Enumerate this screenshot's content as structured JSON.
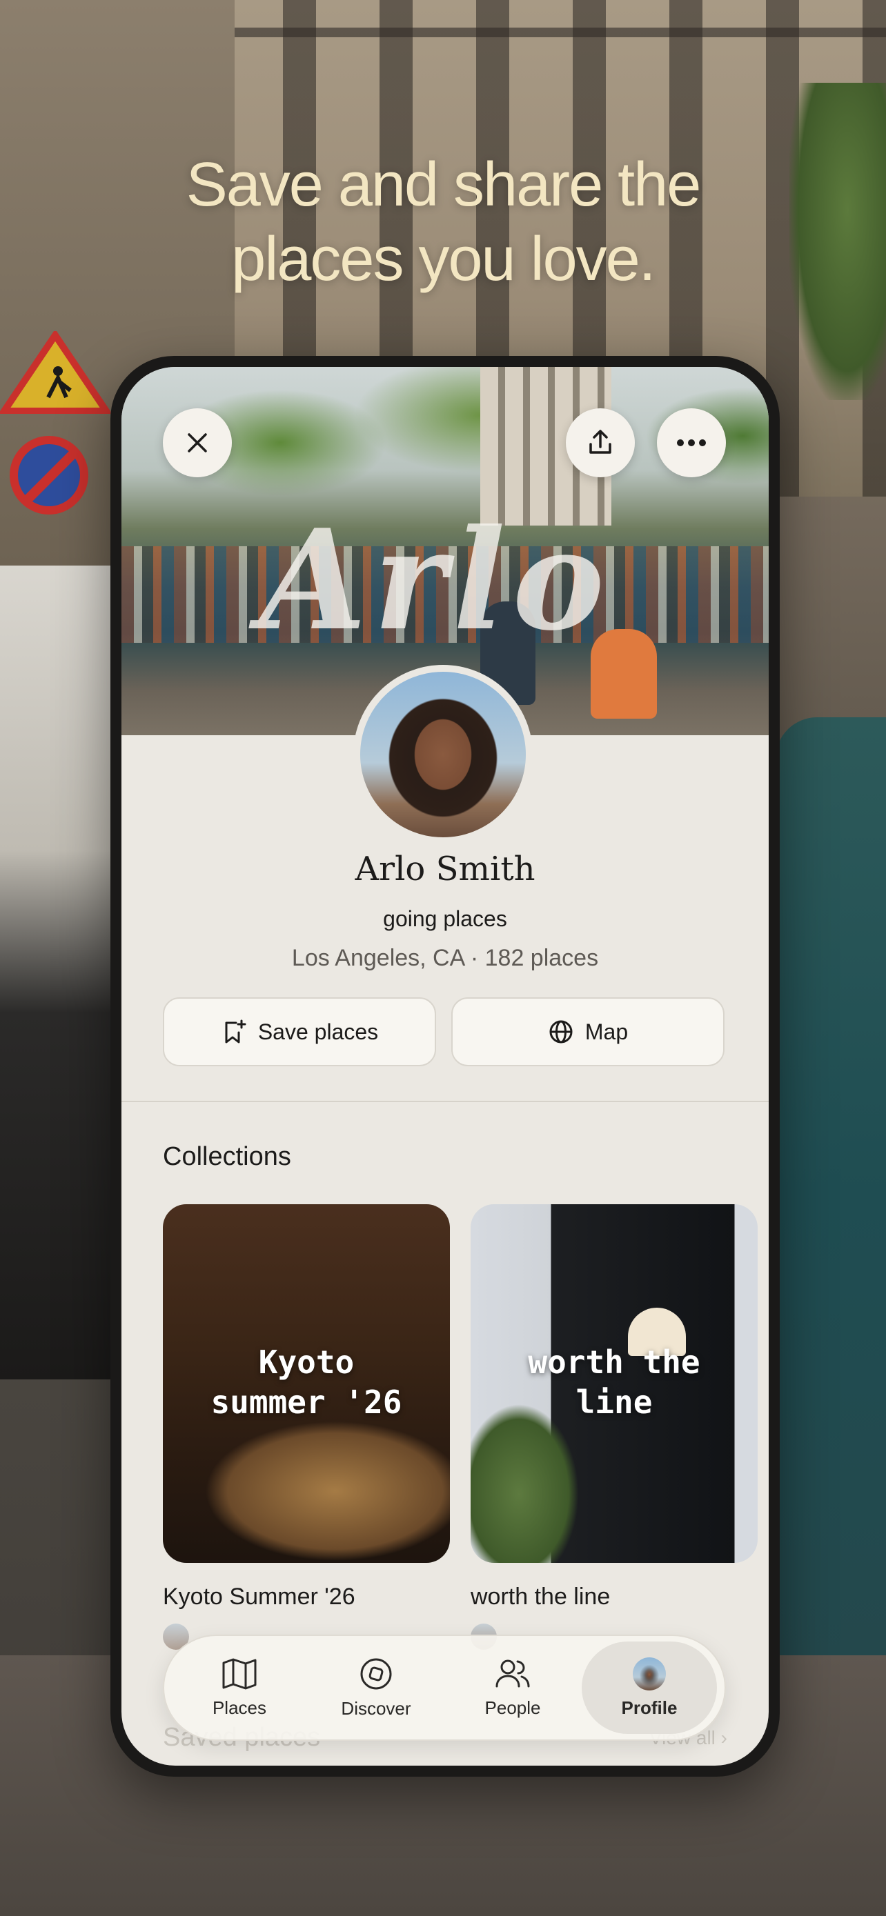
{
  "headline": "Save and share the\nplaces you love.",
  "cover": {
    "scribble_text": "Arlo"
  },
  "profile": {
    "name": "Arlo Smith",
    "tagline": "going places",
    "meta": "Los Angeles, CA · 182 places"
  },
  "actions": {
    "save_label": "Save places",
    "map_label": "Map"
  },
  "collections": {
    "title": "Collections",
    "items": [
      {
        "overlay": "Kyoto\nsummer '26",
        "title": "Kyoto Summer '26"
      },
      {
        "overlay": "worth the\nline",
        "title": "worth the line"
      }
    ]
  },
  "saved": {
    "title": "Saved places",
    "view_all": "View all"
  },
  "tabbar": {
    "tabs": [
      {
        "label": "Places",
        "icon": "map-icon"
      },
      {
        "label": "Discover",
        "icon": "discover-icon"
      },
      {
        "label": "People",
        "icon": "people-icon"
      },
      {
        "label": "Profile",
        "icon": "avatar"
      }
    ],
    "active_tab": "Profile"
  },
  "colors": {
    "headline": "#f3e6c2",
    "screen_bg": "#ebe8e2",
    "button_bg": "#f8f6f1",
    "text": "#1c1b1a"
  }
}
